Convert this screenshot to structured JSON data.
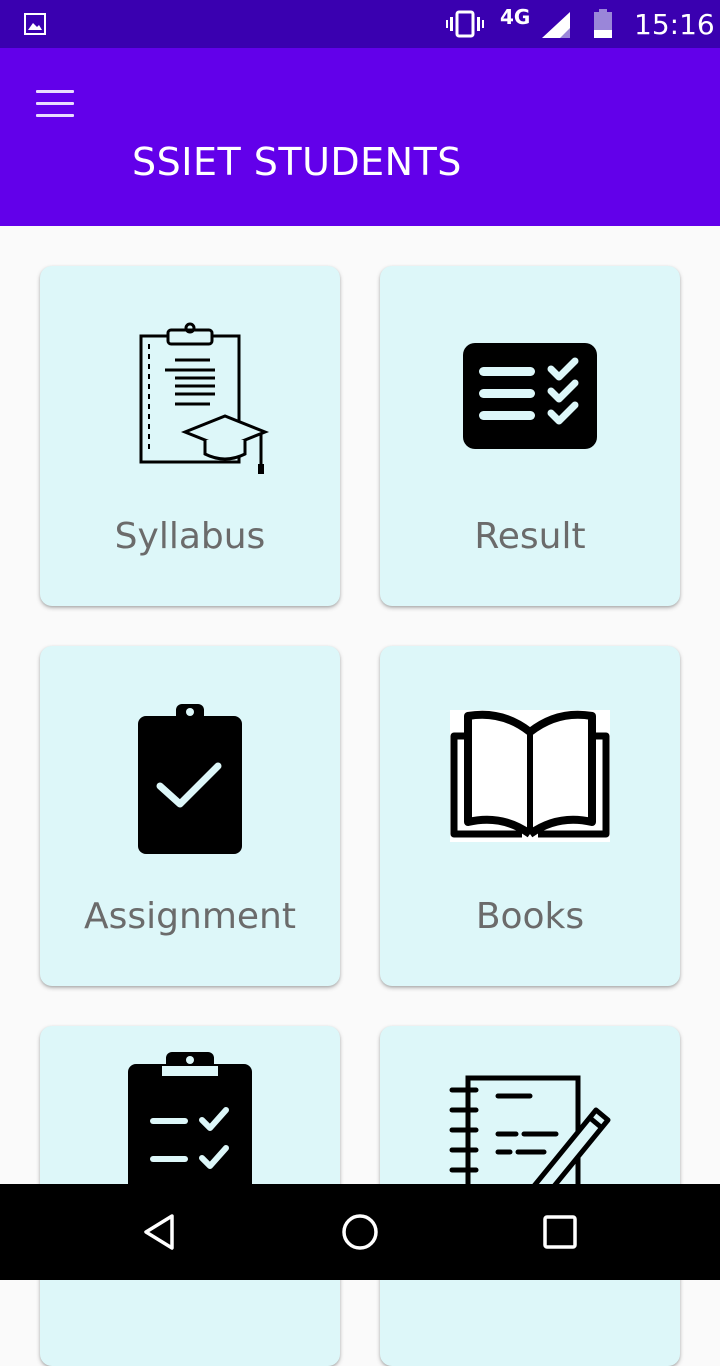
{
  "status_bar": {
    "network": "4G",
    "time": "15:16"
  },
  "app_bar": {
    "title": "SSIET STUDENTS"
  },
  "cards": [
    {
      "label": "Syllabus"
    },
    {
      "label": "Result"
    },
    {
      "label": "Assignment"
    },
    {
      "label": "Books"
    },
    {
      "label": ""
    },
    {
      "label": ""
    }
  ],
  "colors": {
    "status_bar": "#3a00b0",
    "app_bar": "#6200ea",
    "card_background": "#ddf7f9",
    "card_label": "#6b6b6b"
  }
}
